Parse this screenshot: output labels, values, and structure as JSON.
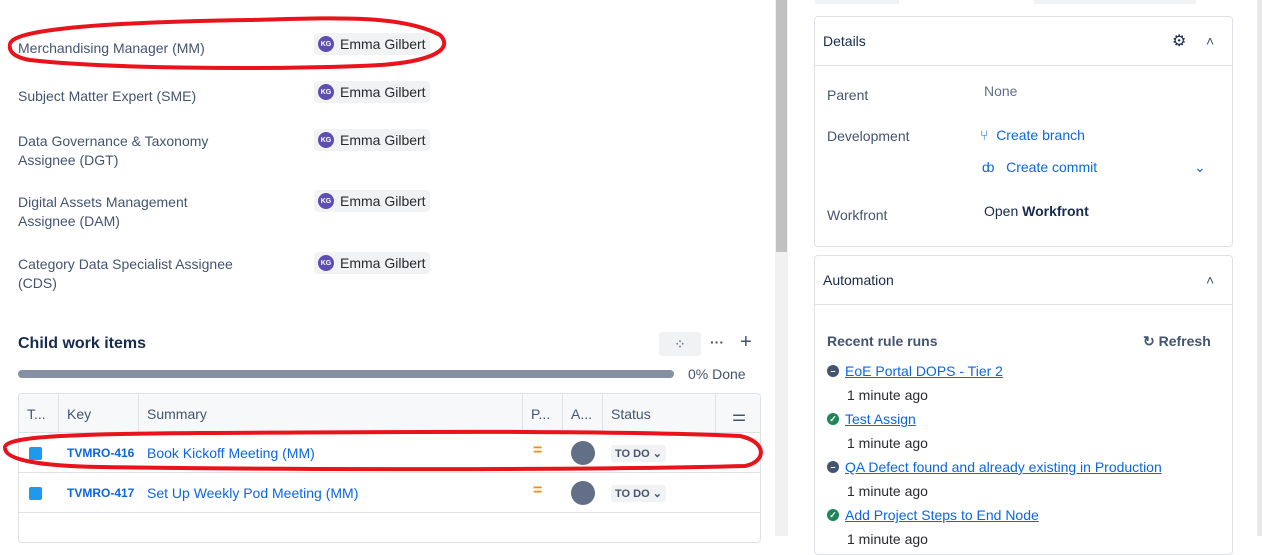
{
  "fields": [
    {
      "label": "Merchandising Manager (MM)",
      "value": "Emma Gilbert",
      "initials": "KG"
    },
    {
      "label": "Subject Matter Expert (SME)",
      "value": "Emma Gilbert",
      "initials": "KG"
    },
    {
      "label": "Data Governance & Taxonomy Assignee (DGT)",
      "value": "Emma Gilbert",
      "initials": "KG"
    },
    {
      "label": "Digital Assets Management Assignee (DAM)",
      "value": "Emma Gilbert",
      "initials": "KG"
    },
    {
      "label": "Category Data Specialist Assignee (CDS)",
      "value": "Emma Gilbert",
      "initials": "KG"
    }
  ],
  "child": {
    "title": "Child work items",
    "progress_percent": 0,
    "progress_label": "0% Done",
    "columns": [
      "T...",
      "Key",
      "Summary",
      "P...",
      "A...",
      "Status"
    ],
    "rows": [
      {
        "key": "TVMRO-416",
        "summary": "Book Kickoff Meeting (MM)",
        "status": "TO DO"
      },
      {
        "key": "TVMRO-417",
        "summary": "Set Up Weekly Pod Meeting (MM)",
        "status": "TO DO"
      }
    ]
  },
  "details": {
    "title": "Details",
    "parent_label": "Parent",
    "parent_value": "None",
    "development_label": "Development",
    "create_branch": "Create branch",
    "create_commit": "Create commit",
    "workfront_label": "Workfront",
    "workfront_open": "Open",
    "workfront_name": "Workfront"
  },
  "automation": {
    "title": "Automation",
    "recent": "Recent rule runs",
    "refresh": "Refresh",
    "runs": [
      {
        "name": "EoE Portal DOPS - Tier 2",
        "time": "1 minute ago",
        "state": "neutral"
      },
      {
        "name": "Test Assign",
        "time": "1 minute ago",
        "state": "success"
      },
      {
        "name": "QA Defect found and already existing in Production",
        "time": "1 minute ago",
        "state": "neutral"
      },
      {
        "name": "Add Project Steps to End Node",
        "time": "1 minute ago",
        "state": "success"
      }
    ]
  },
  "colors": {
    "link": "#0c66e4",
    "annotation": "#e8131b",
    "success": "#1f845a",
    "neutral": "#44546f"
  }
}
